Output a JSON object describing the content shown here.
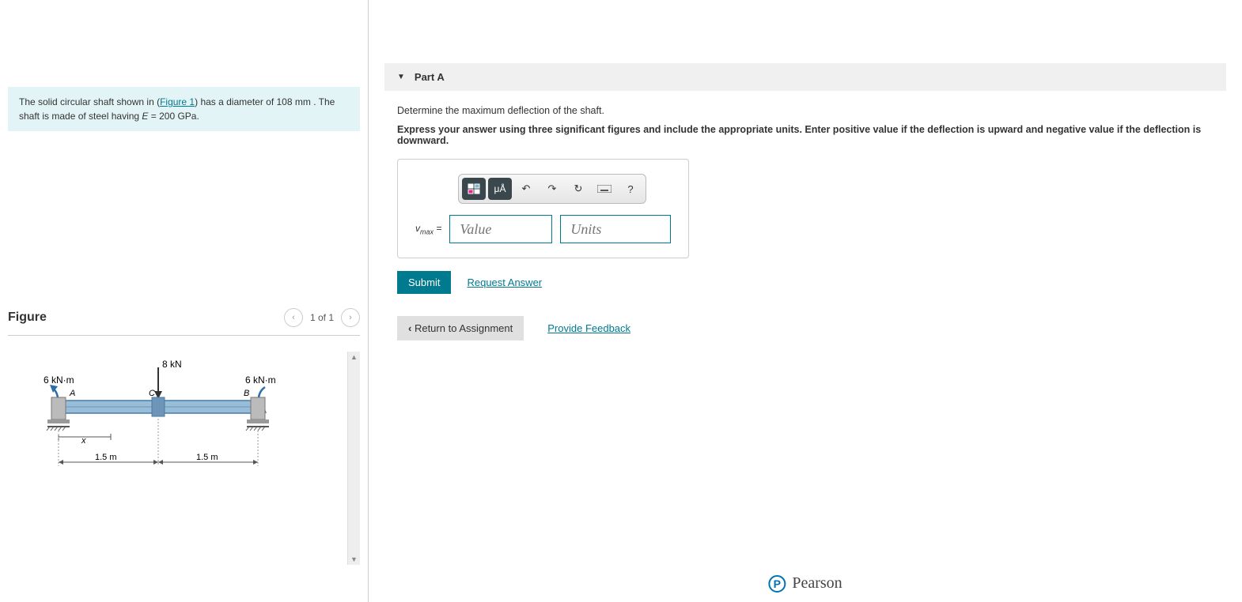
{
  "problem": {
    "text_pre": "The solid circular shaft shown in (",
    "figure_link": "Figure 1",
    "text_mid": ") has a diameter of ",
    "diameter_val": "108",
    "diameter_unit": "mm",
    "text_mid2": " . The shaft is made of steel having ",
    "modulus_var": "E",
    "modulus_eq": " = 200 ",
    "modulus_unit": "GPa",
    "text_end": "."
  },
  "figure": {
    "title": "Figure",
    "nav_text": "1 of 1",
    "diagram": {
      "force_top": "8 kN",
      "moment_left": "6 kN·m",
      "moment_right": "6 kN·m",
      "point_a": "A",
      "point_b": "B",
      "point_c": "C",
      "var_x": "x",
      "span_left": "1.5 m",
      "span_right": "1.5 m"
    }
  },
  "part": {
    "label": "Part A",
    "prompt1": "Determine the maximum deflection of the shaft.",
    "prompt2": "Express your answer using three significant figures and include the appropriate units. Enter positive value if the deflection is upward and negative value if the deflection is downward.",
    "var_symbol": "v",
    "var_sub": "max",
    "value_placeholder": "Value",
    "units_placeholder": "Units",
    "toolbar_ua": "μÅ",
    "toolbar_help": "?"
  },
  "actions": {
    "submit": "Submit",
    "request": "Request Answer",
    "return": "Return to Assignment",
    "feedback": "Provide Feedback"
  },
  "footer": {
    "brand": "Pearson",
    "logo_letter": "P"
  }
}
